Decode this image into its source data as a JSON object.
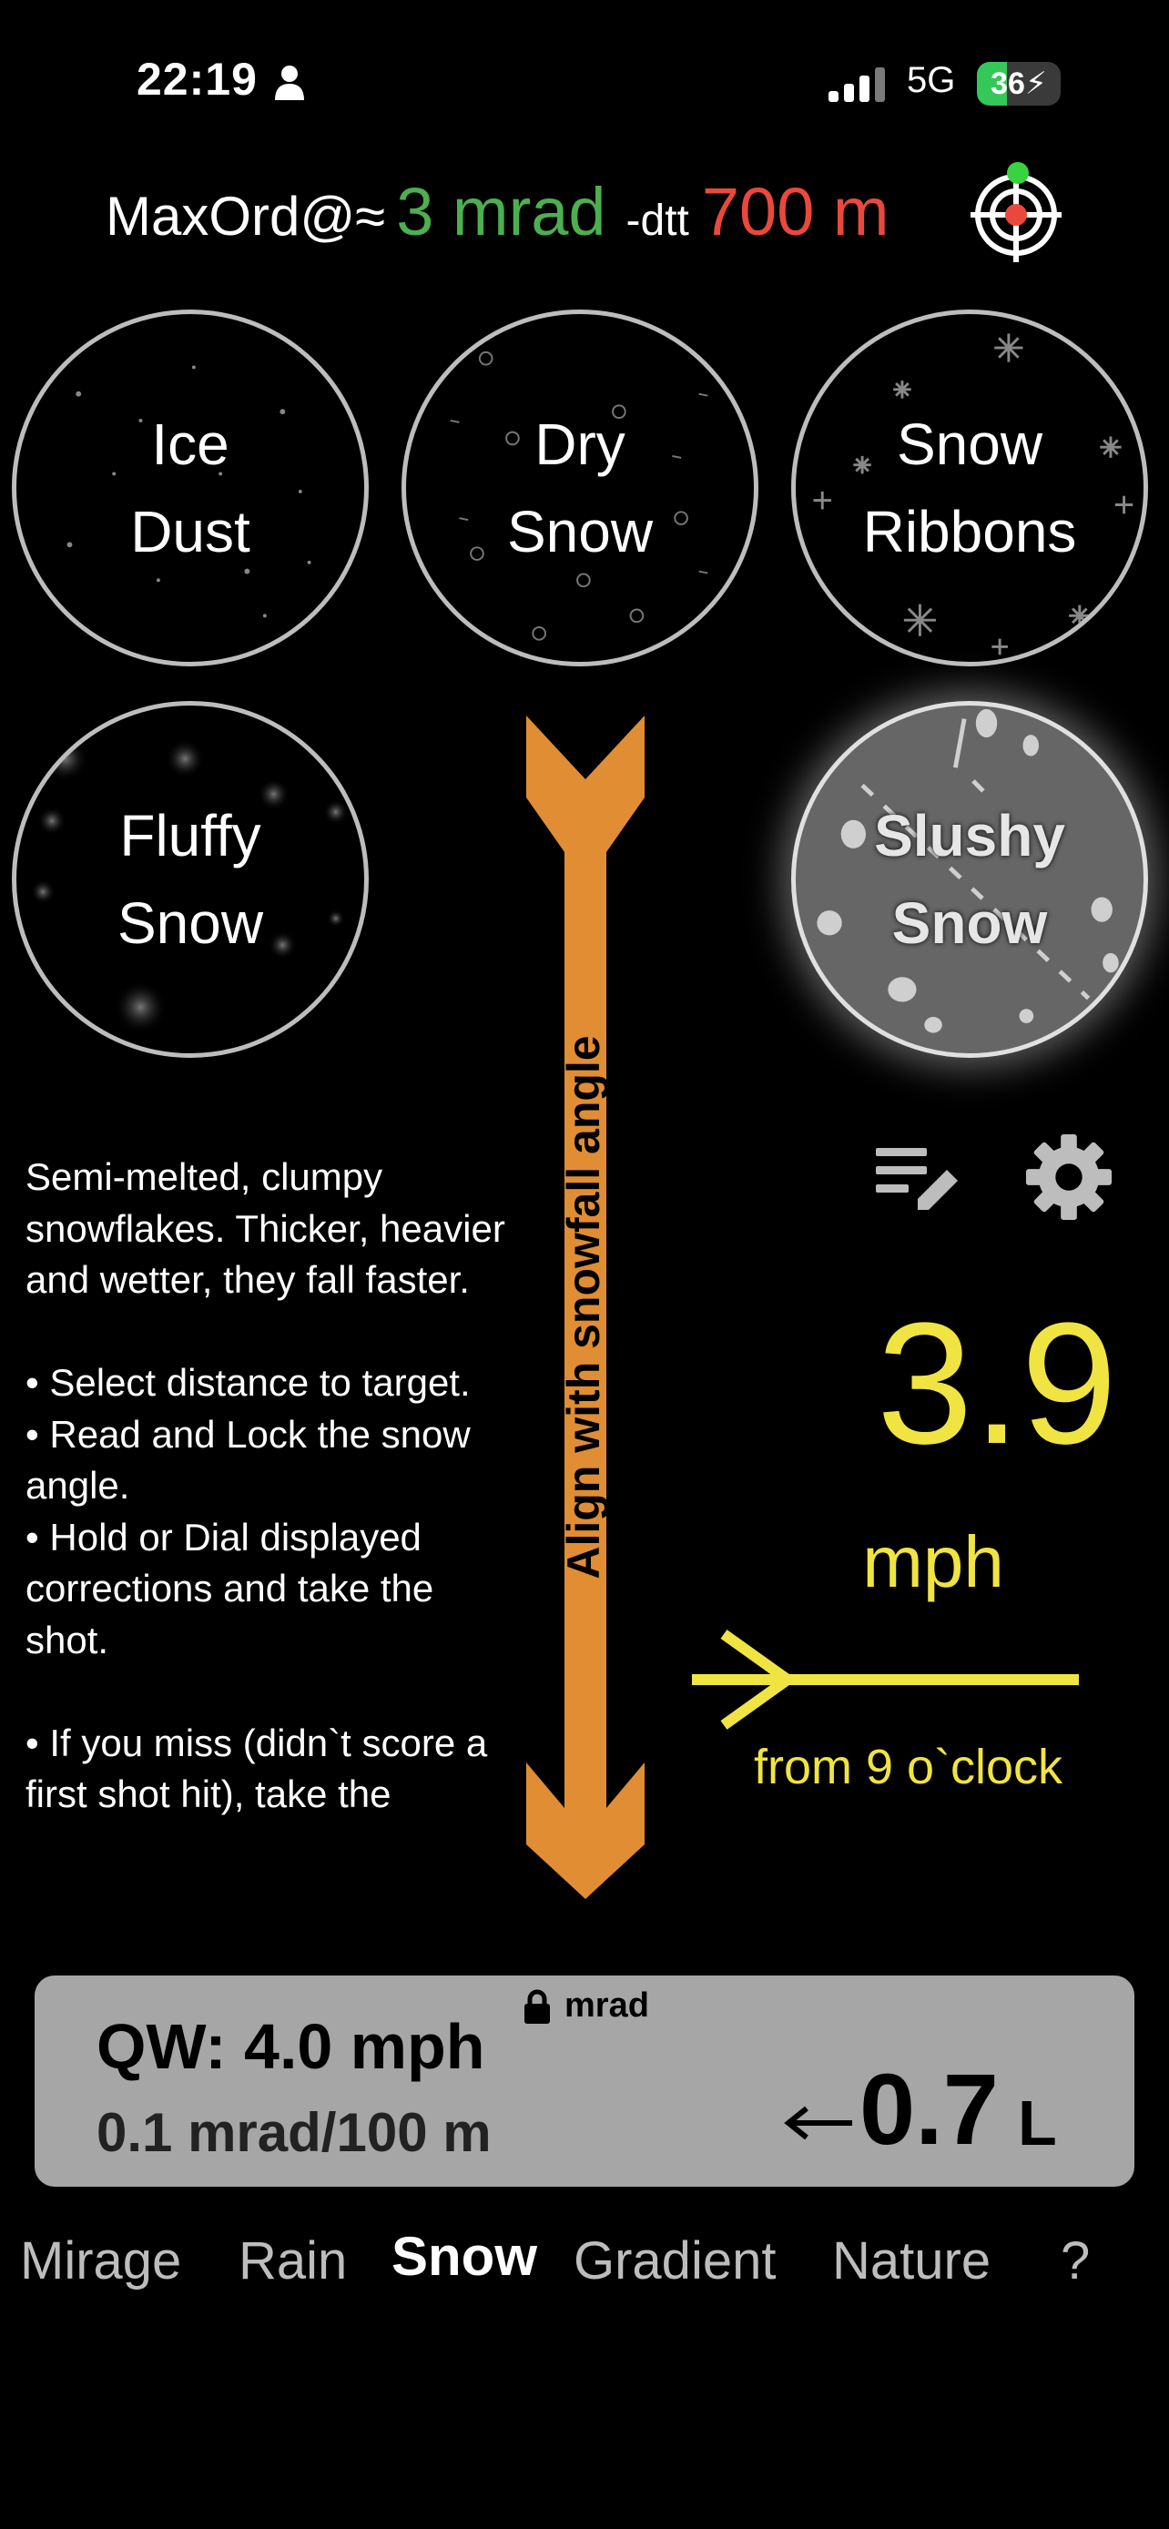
{
  "status_bar": {
    "time": "22:19",
    "network": "5G",
    "battery_level": 36,
    "battery_text": "36",
    "person_icon": "person-icon",
    "signal_icon": "cellular-signal-icon",
    "charging_icon": "charging-bolt-icon"
  },
  "header": {
    "prefix": "MaxOrd@≈",
    "mrad_value": "3 mrad",
    "dtt_label": "-dtt",
    "distance": "700 m",
    "mrad_color": "#4caf50",
    "distance_color": "#e9493c",
    "target_icon": "target-crosshair-icon"
  },
  "snow_types": [
    {
      "line1": "Ice",
      "line2": "Dust",
      "selected": false
    },
    {
      "line1": "Dry",
      "line2": "Snow",
      "selected": false
    },
    {
      "line1": "Snow",
      "line2": "Ribbons",
      "selected": false
    },
    {
      "line1": "Fluffy",
      "line2": "Snow",
      "selected": false
    },
    {
      "line1": "Slushy",
      "line2": "Snow",
      "selected": true
    }
  ],
  "arrow": {
    "label": "Align with snowfall angle",
    "color": "#e08d34"
  },
  "description": "Semi-melted, clumpy snowflakes. Thicker, heavier and wetter, they fall faster.\n\n• Select distance to target.\n• Read and Lock the snow angle.\n• Hold or Dial displayed corrections and take the shot.\n\n• If you miss (didn`t score a first shot hit), take the",
  "wind": {
    "speed": "3.9",
    "unit": "mph",
    "direction": "from 9 o`clock",
    "color": "#f0e442"
  },
  "panel": {
    "lock_unit": "mrad",
    "qw": "QW: 4.0 mph",
    "qw_sub": "0.1 mrad/100 m",
    "correction": "0.7",
    "correction_dir": "L"
  },
  "icons": {
    "notes": "notes-edit-icon",
    "settings": "gear-icon",
    "lock": "lock-icon"
  },
  "tabs": [
    {
      "label": "Mirage",
      "active": false
    },
    {
      "label": "Rain",
      "active": false
    },
    {
      "label": "Snow",
      "active": true
    },
    {
      "label": "Gradient",
      "active": false
    },
    {
      "label": "Nature",
      "active": false
    },
    {
      "label": "?",
      "active": false
    }
  ]
}
